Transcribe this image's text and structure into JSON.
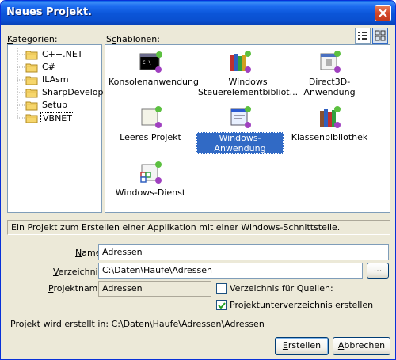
{
  "window": {
    "title": "Neues Projekt."
  },
  "labels": {
    "kategorien": "Kategorien:",
    "schablonen": "Schablonen:",
    "name": "Name",
    "verzeichnis": "Verzeichnis:",
    "projektname": "Projektname:",
    "created_in": "Projekt wird erstellt in: C:\\Daten\\Haufe\\Adressen\\Adressen"
  },
  "categories": [
    {
      "label": "C++.NET"
    },
    {
      "label": "C#"
    },
    {
      "label": "ILAsm"
    },
    {
      "label": "SharpDevelop"
    },
    {
      "label": "Setup"
    },
    {
      "label": "VBNET",
      "selected": true
    }
  ],
  "templates": [
    {
      "label": "Konsolenanwendung",
      "icon": "console-app-icon"
    },
    {
      "label": "Windows Steuerelementbibliot...",
      "icon": "control-library-icon"
    },
    {
      "label": "Direct3D-Anwendung",
      "icon": "direct3d-app-icon"
    },
    {
      "label": "Leeres Projekt",
      "icon": "empty-project-icon"
    },
    {
      "label": "Windows-Anwendung",
      "icon": "windows-app-icon",
      "selected": true
    },
    {
      "label": "Klassenbibliothek",
      "icon": "class-library-icon"
    },
    {
      "label": "Windows-Dienst",
      "icon": "windows-service-icon"
    }
  ],
  "description": "Ein Projekt zum Erstellen einer Applikation mit einer Windows-Schnittstelle.",
  "fields": {
    "name": "Adressen",
    "verzeichnis": "C:\\Daten\\Haufe\\Adressen",
    "projektname": "Adressen",
    "browse_label": "..."
  },
  "checkboxes": {
    "verzeichnis_quellen": {
      "label": "Verzeichnis für Quellen:",
      "checked": false
    },
    "unterverzeichnis": {
      "label": "Projektunterverzeichnis erstellen",
      "checked": true
    }
  },
  "buttons": {
    "create": "Erstellen",
    "cancel": "Abbrechen"
  },
  "colors": {
    "titlebar": "#0a4fcf",
    "selection": "#316ac5",
    "dialog_bg": "#ece9d8"
  }
}
